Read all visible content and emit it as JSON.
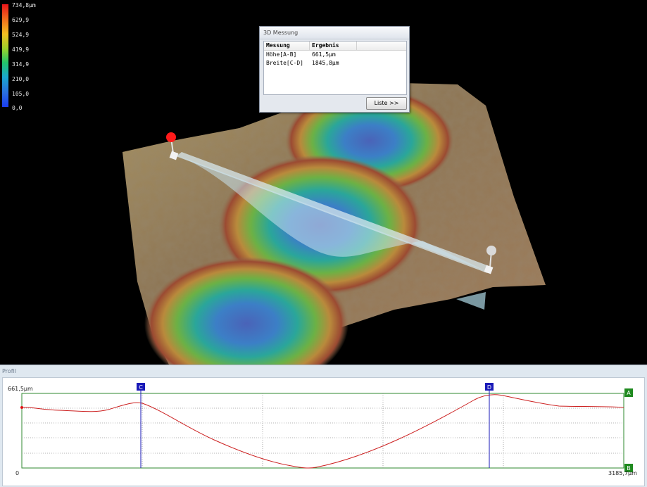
{
  "legend": {
    "labels": [
      "734,8µm",
      "629,9",
      "524,9",
      "419,9",
      "314,9",
      "210,0",
      "105,0",
      "0,0"
    ]
  },
  "measure_window": {
    "title": "3D Messung",
    "columns": [
      "Messung",
      "Ergebnis"
    ],
    "rows": [
      {
        "name": "Höhe[A-B]",
        "value": "661,5µm"
      },
      {
        "name": "Breite[C-D]",
        "value": "1845,8µm"
      }
    ],
    "list_button_label": "Liste >>"
  },
  "profile": {
    "title": "Profil",
    "y_max_label": "661,5µm",
    "x_start_label": "0",
    "x_end_label": "3185,7µm",
    "markers": {
      "c": "C",
      "d": "D",
      "a": "A",
      "b": "B"
    }
  },
  "colors": {
    "profile_curve": "#cc1f1f",
    "marker_blue": "#1a1ab8",
    "marker_green": "#1f8a1f",
    "start_point": "#ff1a1a",
    "end_point": "#d9d9d9"
  }
}
